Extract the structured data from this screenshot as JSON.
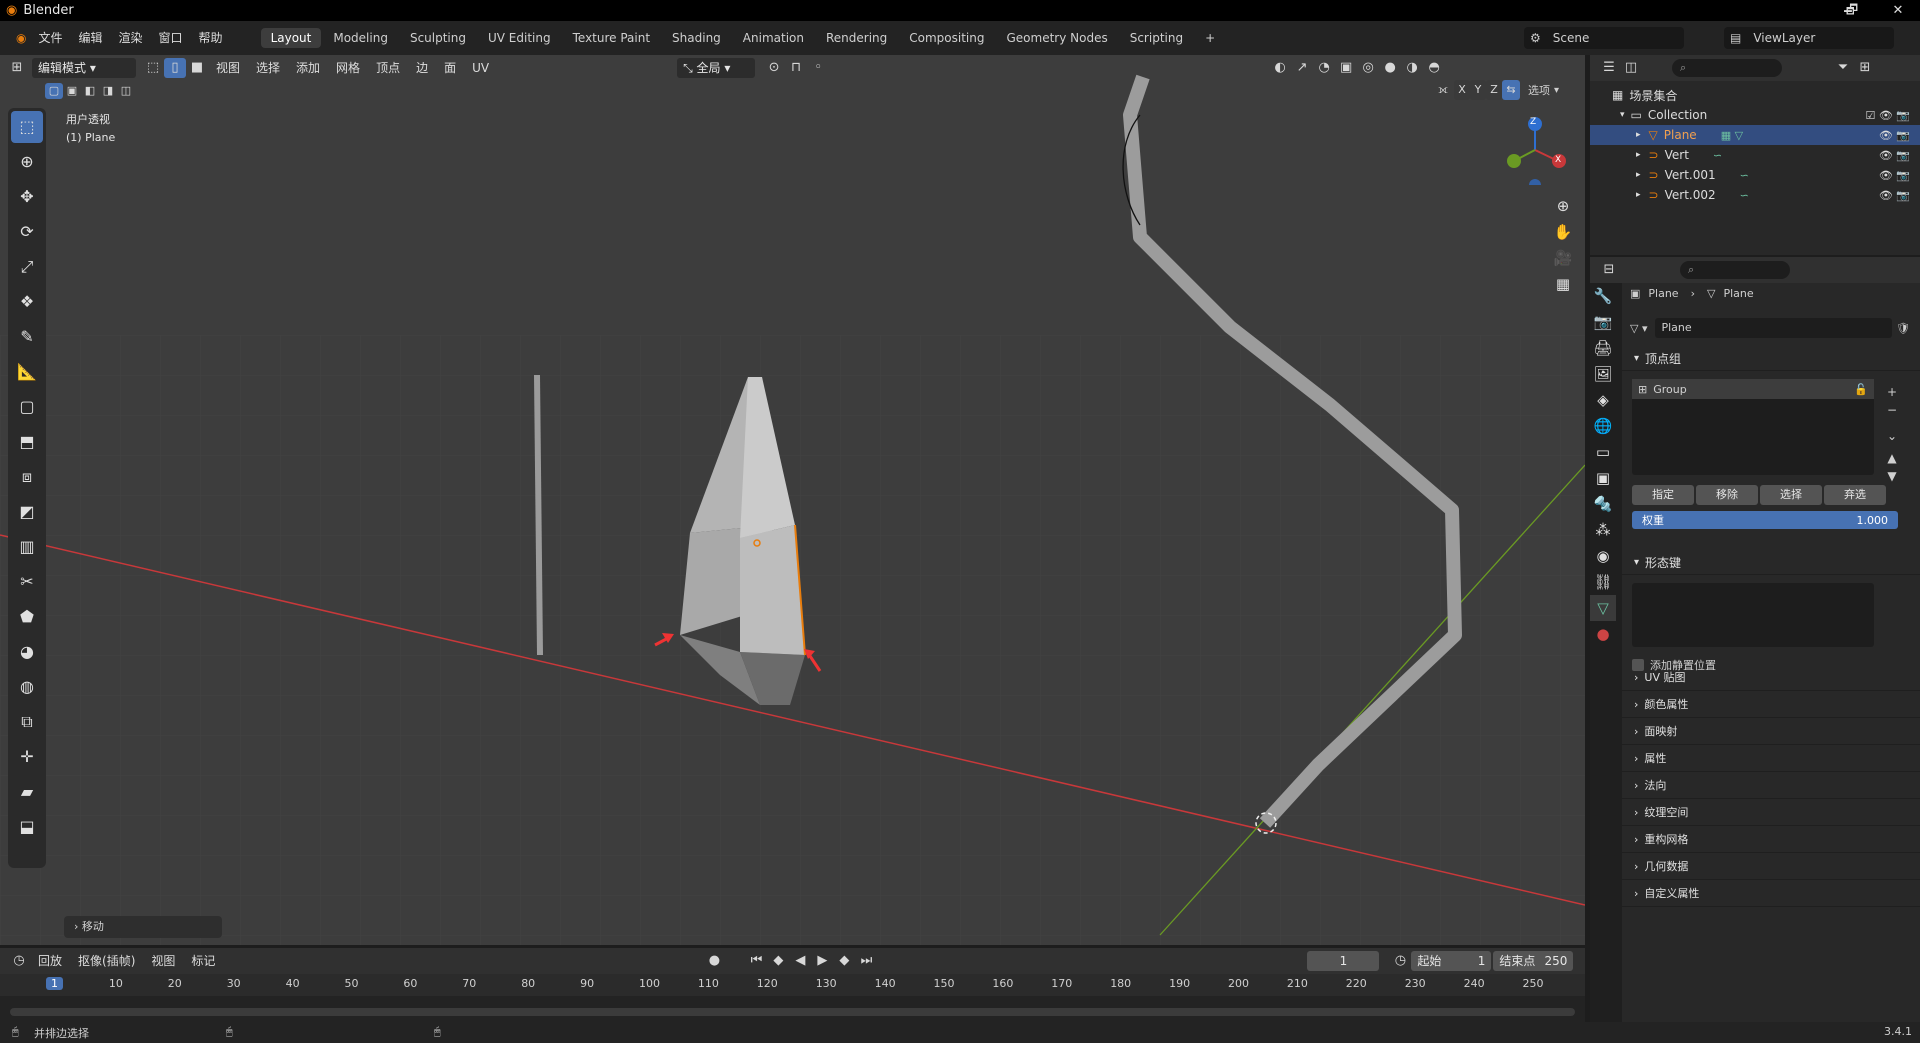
{
  "window": {
    "title": "Blender",
    "minimize": "🗕",
    "restore": "🗗",
    "close": "✕"
  },
  "menubar": {
    "menus": [
      "文件",
      "编辑",
      "渲染",
      "窗口",
      "帮助"
    ],
    "workspaces": [
      "Layout",
      "Modeling",
      "Sculpting",
      "UV Editing",
      "Texture Paint",
      "Shading",
      "Animation",
      "Rendering",
      "Compositing",
      "Geometry Nodes",
      "Scripting"
    ],
    "active_workspace": "Layout",
    "add_tab": "+",
    "scene_label": "Scene",
    "viewlayer_label": "ViewLayer"
  },
  "viewport": {
    "mode_label": "编辑模式",
    "menus": [
      "视图",
      "选择",
      "添加",
      "网格",
      "顶点",
      "边",
      "面",
      "UV"
    ],
    "transform_orientation": "全局",
    "options_label": "选项",
    "axis_x": "X",
    "axis_y": "Y",
    "axis_z": "Z",
    "view_name": "用户透视",
    "object_name": "(1) Plane",
    "operator_panel": "移动",
    "gizmo": {
      "z": "Z",
      "x": "X"
    }
  },
  "outliner": {
    "search_placeholder": "",
    "scene_collection": "场景集合",
    "collection": "Collection",
    "objects": [
      {
        "name": "Plane",
        "selected": true
      },
      {
        "name": "Vert",
        "selected": false
      },
      {
        "name": "Vert.001",
        "selected": false
      },
      {
        "name": "Vert.002",
        "selected": false
      }
    ]
  },
  "properties": {
    "breadcrumb_object": "Plane",
    "breadcrumb_data": "Plane",
    "mesh_name": "Plane",
    "vertex_groups_title": "顶点组",
    "vertex_group_item": "Group",
    "assign": "指定",
    "remove": "移除",
    "select": "选择",
    "deselect": "弃选",
    "weight_label": "权重",
    "weight_value": "1.000",
    "shape_keys_title": "形态键",
    "add_rest_position": "添加静置位置",
    "panels": [
      "UV 贴图",
      "颜色属性",
      "面映射",
      "属性",
      "法向",
      "纹理空间",
      "重构网格",
      "几何数据",
      "自定义属性"
    ]
  },
  "timeline": {
    "menus": [
      "回放",
      "抠像(插帧)",
      "视图",
      "标记"
    ],
    "current_frame": "1",
    "start_label": "起始",
    "start_value": "1",
    "end_label": "结束点",
    "end_value": "250",
    "ticks": [
      "1",
      "10",
      "20",
      "30",
      "40",
      "50",
      "60",
      "70",
      "80",
      "90",
      "100",
      "110",
      "120",
      "130",
      "140",
      "150",
      "160",
      "170",
      "180",
      "190",
      "200",
      "210",
      "220",
      "230",
      "240",
      "250"
    ]
  },
  "statusbar": {
    "hint": "并排边选择",
    "version": "3.4.1"
  },
  "colors": {
    "accent": "#4772b3",
    "orange": "#e87d0d",
    "x_axis": "#c8383a",
    "y_axis": "#6a9a23",
    "z_axis": "#2e6fd1"
  }
}
